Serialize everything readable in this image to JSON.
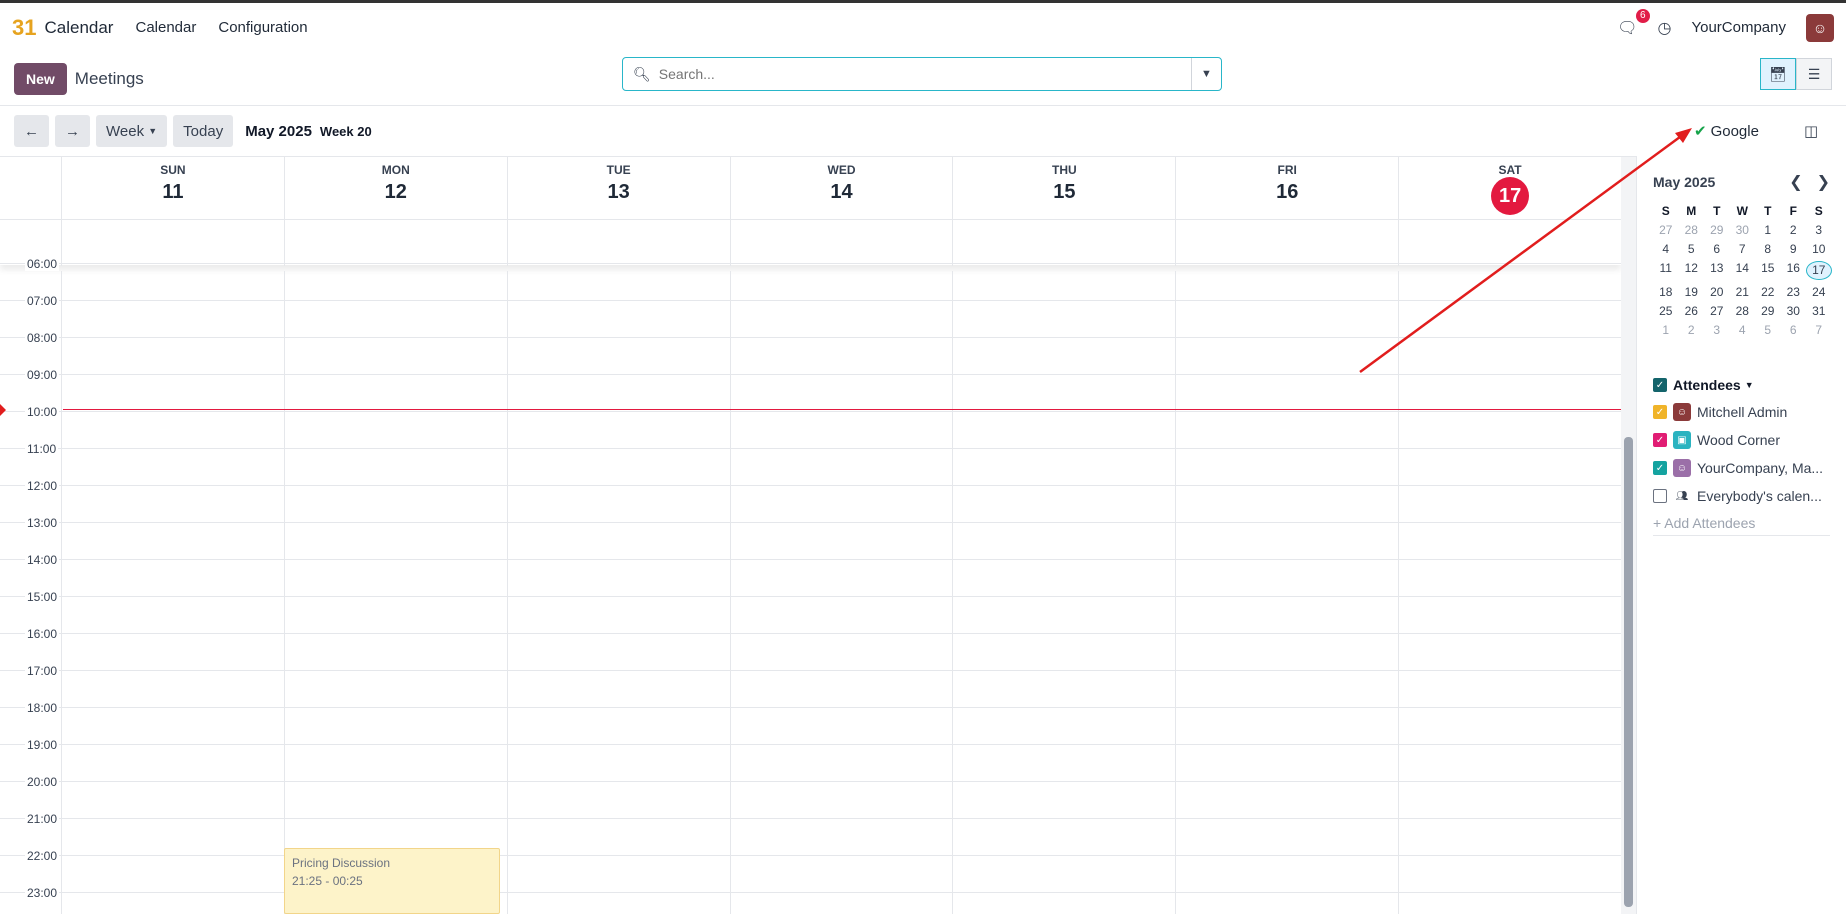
{
  "topbar": {
    "logo": "31",
    "app_name": "Calendar",
    "menu": [
      "Calendar",
      "Configuration"
    ],
    "chat_badge": "6",
    "company": "YourCompany"
  },
  "control": {
    "new_label": "New",
    "breadcrumb": "Meetings",
    "search_placeholder": "Search..."
  },
  "nav": {
    "scale_label": "Week",
    "today_label": "Today",
    "period": "May 2025",
    "week_label": "Week 20",
    "google_label": "Google"
  },
  "days": [
    {
      "name": "SUN",
      "date": "11"
    },
    {
      "name": "MON",
      "date": "12"
    },
    {
      "name": "TUE",
      "date": "13"
    },
    {
      "name": "WED",
      "date": "14"
    },
    {
      "name": "THU",
      "date": "15"
    },
    {
      "name": "FRI",
      "date": "16"
    },
    {
      "name": "SAT",
      "date": "17"
    }
  ],
  "hours": [
    "06:00",
    "07:00",
    "08:00",
    "09:00",
    "10:00",
    "11:00",
    "12:00",
    "13:00",
    "14:00",
    "15:00",
    "16:00",
    "17:00",
    "18:00",
    "19:00",
    "20:00",
    "21:00",
    "22:00",
    "23:00"
  ],
  "event": {
    "title": "Pricing Discussion",
    "time": "21:25 - 00:25"
  },
  "mini_calendar": {
    "title": "May 2025",
    "weekdays": [
      "S",
      "M",
      "T",
      "W",
      "T",
      "F",
      "S"
    ],
    "weeks": [
      [
        "27",
        "28",
        "29",
        "30",
        "1",
        "2",
        "3"
      ],
      [
        "4",
        "5",
        "6",
        "7",
        "8",
        "9",
        "10"
      ],
      [
        "11",
        "12",
        "13",
        "14",
        "15",
        "16",
        "17"
      ],
      [
        "18",
        "19",
        "20",
        "21",
        "22",
        "23",
        "24"
      ],
      [
        "25",
        "26",
        "27",
        "28",
        "29",
        "30",
        "31"
      ],
      [
        "1",
        "2",
        "3",
        "4",
        "5",
        "6",
        "7"
      ]
    ],
    "today": "17"
  },
  "attendees": {
    "title": "Attendees",
    "items": [
      {
        "name": "Mitchell Admin",
        "checked": true,
        "color": "#f0b429"
      },
      {
        "name": "Wood Corner",
        "checked": true,
        "color": "#e11d74"
      },
      {
        "name": "YourCompany, Ma...",
        "checked": true,
        "color": "#14a3a0"
      },
      {
        "name": "Everybody's calen...",
        "checked": false,
        "color": "#ffffff"
      }
    ],
    "add_label": "+ Add Attendees"
  }
}
